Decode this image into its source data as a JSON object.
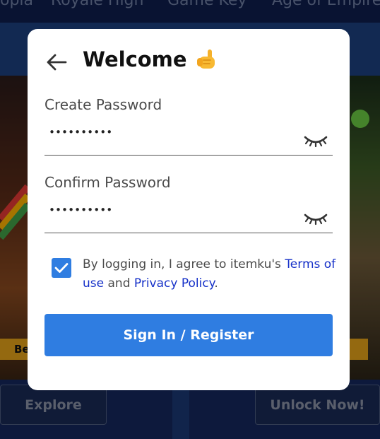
{
  "background": {
    "nav_items": [
      "opia",
      "Royale High",
      "Game Key",
      "Age of Empire"
    ],
    "promo_left": "Be",
    "buttons": {
      "explore": "Explore",
      "unlock": "Unlock Now!"
    }
  },
  "modal": {
    "title": "Welcome",
    "title_icon": "thumbs-up-hand-emoji",
    "back_icon": "arrow-left-icon",
    "create_password": {
      "label": "Create Password",
      "value": "••••••••••",
      "toggle_icon": "eye-closed-icon"
    },
    "confirm_password": {
      "label": "Confirm Password",
      "value": "••••••••••",
      "toggle_icon": "eye-closed-icon"
    },
    "consent": {
      "checked": true,
      "text_before": "By logging in, I agree to itemku's ",
      "terms_link": "Terms of use",
      "text_middle": " and ",
      "privacy_link": "Privacy Policy",
      "text_after": "."
    },
    "submit_label": "Sign In / Register"
  },
  "colors": {
    "accent": "#2f7de1",
    "link": "#1530c8",
    "background_dark": "#0e1c4a"
  }
}
